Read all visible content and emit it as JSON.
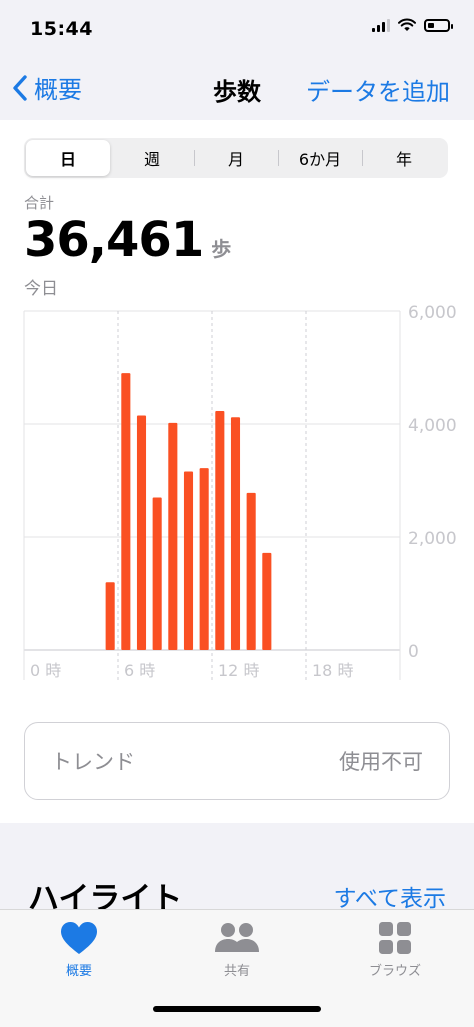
{
  "status_bar": {
    "time": "15:44",
    "signal_bars": 3,
    "battery_level": 0.25
  },
  "nav": {
    "back_label": "概要",
    "title": "歩数",
    "action_label": "データを追加"
  },
  "segments": [
    {
      "label": "日",
      "active": true
    },
    {
      "label": "週",
      "active": false
    },
    {
      "label": "月",
      "active": false
    },
    {
      "label": "6か月",
      "active": false
    },
    {
      "label": "年",
      "active": false
    }
  ],
  "summary": {
    "total_label": "合計",
    "total_value": "36,461",
    "unit": "歩",
    "date_label": "今日"
  },
  "chart_data": {
    "type": "bar",
    "x_unit": "hour",
    "x": [
      5,
      6,
      7,
      8,
      9,
      10,
      11,
      12,
      13,
      14,
      15
    ],
    "values": [
      1200,
      4900,
      4150,
      2700,
      4020,
      3160,
      3220,
      4230,
      4120,
      2780,
      1720
    ],
    "xlim": [
      0,
      24
    ],
    "ylim": [
      0,
      6000
    ],
    "y_ticks": [
      "0",
      "2,000",
      "4,000",
      "6,000"
    ],
    "y_tick_values": [
      0,
      2000,
      4000,
      6000
    ],
    "x_ticks": [
      "0 時",
      "6 時",
      "12 時",
      "18 時"
    ],
    "x_tick_values": [
      0,
      6,
      12,
      18
    ],
    "bar_color": "#fa5023",
    "grid": true
  },
  "trend": {
    "label": "トレンド",
    "status": "使用不可"
  },
  "highlights": {
    "title": "ハイライト",
    "see_all": "すべて表示"
  },
  "tabs": [
    {
      "label": "概要",
      "icon": "heart-icon",
      "active": true
    },
    {
      "label": "共有",
      "icon": "people-icon",
      "active": false
    },
    {
      "label": "ブラウズ",
      "icon": "grid-icon",
      "active": false
    }
  ],
  "colors": {
    "accent": "#1c7ae4",
    "bar": "#fa5023",
    "inactive": "#8e8e93"
  }
}
